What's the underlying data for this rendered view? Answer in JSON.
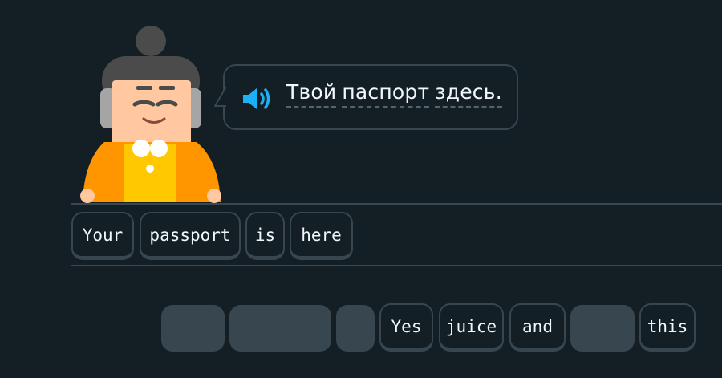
{
  "prompt": {
    "words": [
      "Твой",
      "паспорт",
      "здесь."
    ]
  },
  "answer_tiles": [
    "Your",
    "passport",
    "is",
    "here"
  ],
  "word_bank": [
    "Yes",
    "juice",
    "and",
    "this"
  ],
  "icons": {
    "speaker": "speaker-icon",
    "character": "lily-character"
  },
  "colors": {
    "background": "#131f24",
    "border": "#37464f",
    "speaker": "#1cb0f6",
    "text": "#f1f7fb"
  }
}
